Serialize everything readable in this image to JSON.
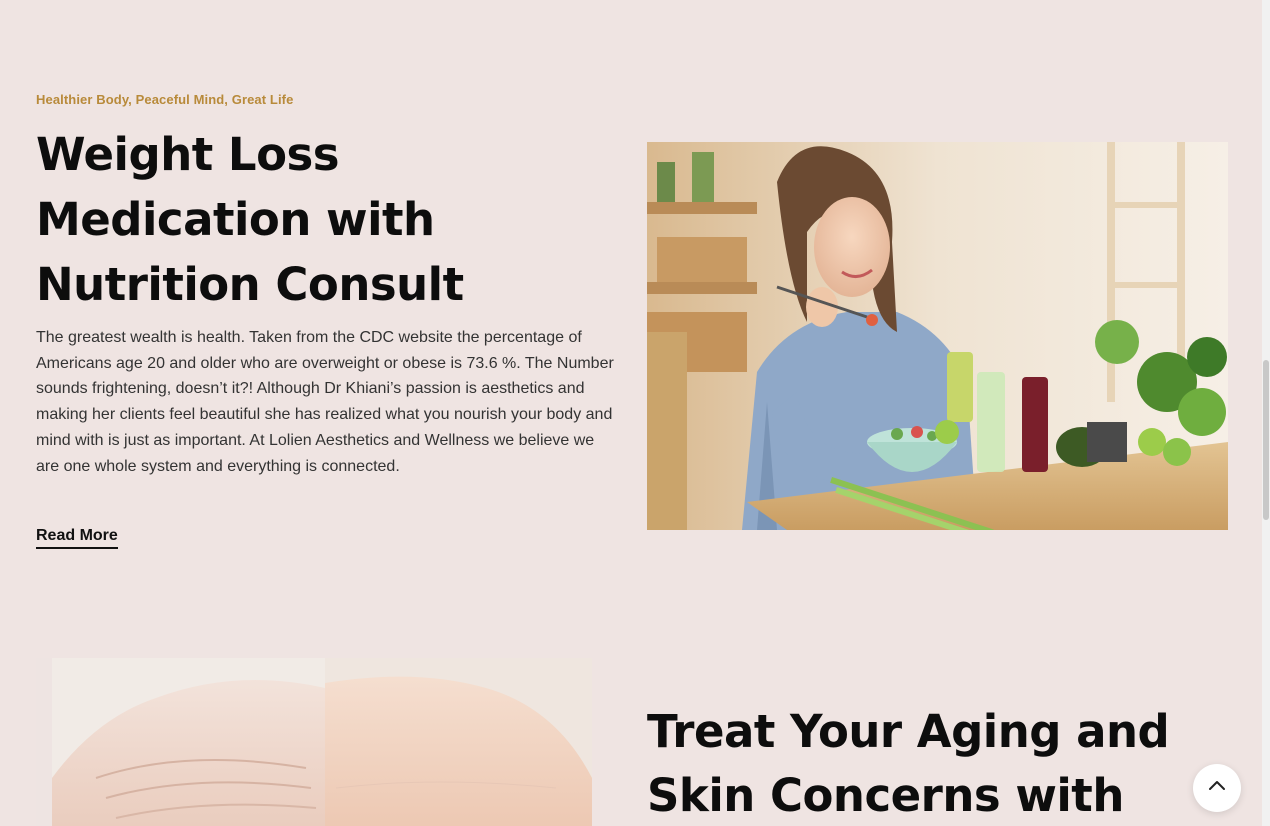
{
  "article1": {
    "eyebrow": "Healthier Body, Peaceful Mind, Great Life",
    "title": "Weight Loss Medication with Nutrition Consult",
    "body": "The greatest wealth is health. Taken from the CDC website the percentage of Americans age 20 and older who are overweight or obese is 73.6 %. The Number sounds frightening, doesn’t it?! Although Dr Khiani’s passion is aesthetics and making her clients feel beautiful she has realized what you nourish your body and mind with is just as important. At Lolien Aesthetics and Wellness we believe we are one whole system and everything is connected.",
    "read_more": "Read More",
    "image": "woman-eating-salad-photo"
  },
  "article2": {
    "title": "Treat Your Aging and Skin Concerns with",
    "image": "aging-skin-forehead-photo"
  },
  "scroll_top": {
    "icon": "chevron-up-icon"
  },
  "colors": {
    "background": "#efe4e2",
    "eyebrow": "#b88a3a",
    "heading": "#0d0d0d",
    "body": "#333333"
  }
}
